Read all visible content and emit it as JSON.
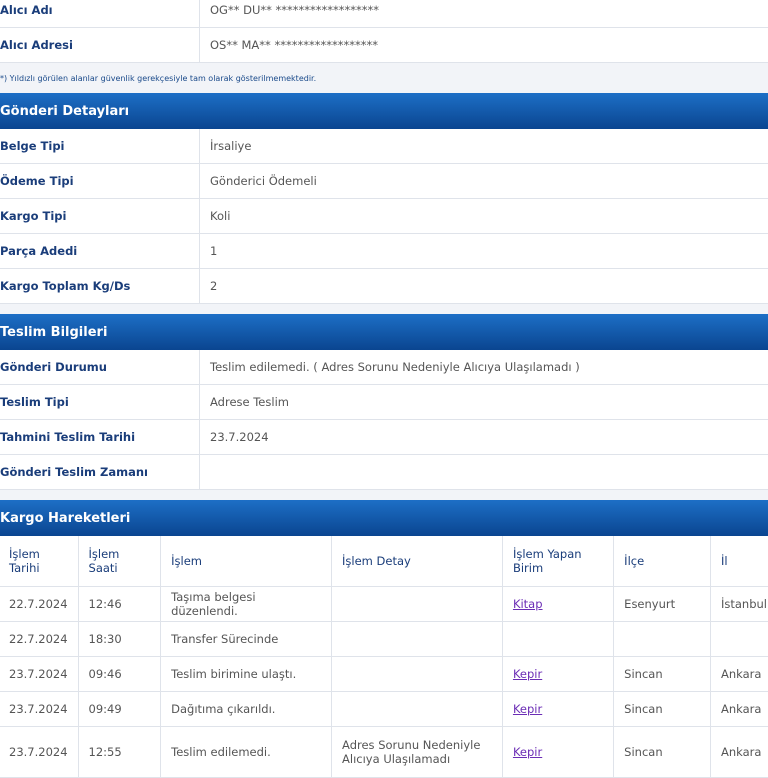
{
  "alici": [
    {
      "label": "Alıcı Adı",
      "value": "OG** DU** ******************"
    },
    {
      "label": "Alıcı Adresi",
      "value": "OS** MA** ******************"
    }
  ],
  "note": "*) Yıldızlı görülen alanlar güvenlik gerekçesiyle tam olarak gösterilmemektedir.",
  "detay": {
    "title": "Gönderi Detayları",
    "rows": [
      {
        "label": "Belge Tipi",
        "value": "İrsaliye"
      },
      {
        "label": "Ödeme Tipi",
        "value": "Gönderici Ödemeli"
      },
      {
        "label": "Kargo Tipi",
        "value": "Koli"
      },
      {
        "label": "Parça Adedi",
        "value": "1"
      },
      {
        "label": "Kargo Toplam Kg/Ds",
        "value": "2"
      }
    ]
  },
  "teslim": {
    "title": "Teslim Bilgileri",
    "rows": [
      {
        "label": "Gönderi Durumu",
        "value": "Teslim edilemedi. ( Adres Sorunu Nedeniyle Alıcıya Ulaşılamadı )"
      },
      {
        "label": "Teslim Tipi",
        "value": "Adrese Teslim"
      },
      {
        "label": "Tahmini Teslim Tarihi",
        "value": "23.7.2024"
      },
      {
        "label": "Gönderi Teslim Zamanı",
        "value": ""
      }
    ]
  },
  "hareket": {
    "title": "Kargo Hareketleri",
    "columns": [
      "İşlem Tarihi",
      "İşlem Saati",
      "İşlem",
      "İşlem Detay",
      "İşlem Yapan Birim",
      "İlçe",
      "İl"
    ],
    "rows": [
      {
        "tarih": "22.7.2024",
        "saat": "12:46",
        "islem": "Taşıma belgesi düzenlendi.",
        "detay": "",
        "birim": "Kitap",
        "ilce": "Esenyurt",
        "il": "İstanbul"
      },
      {
        "tarih": "22.7.2024",
        "saat": "18:30",
        "islem": "Transfer Sürecinde",
        "detay": "",
        "birim": "",
        "ilce": "",
        "il": ""
      },
      {
        "tarih": "23.7.2024",
        "saat": "09:46",
        "islem": "Teslim birimine ulaştı.",
        "detay": "",
        "birim": "Kepir",
        "ilce": "Sincan",
        "il": "Ankara"
      },
      {
        "tarih": "23.7.2024",
        "saat": "09:49",
        "islem": "Dağıtıma çıkarıldı.",
        "detay": "",
        "birim": "Kepir",
        "ilce": "Sincan",
        "il": "Ankara"
      },
      {
        "tarih": "23.7.2024",
        "saat": "12:55",
        "islem": "Teslim edilemedi.",
        "detay": "Adres Sorunu Nedeniyle Alıcıya Ulaşılamadı",
        "birim": "Kepir",
        "ilce": "Sincan",
        "il": "Ankara"
      }
    ]
  }
}
